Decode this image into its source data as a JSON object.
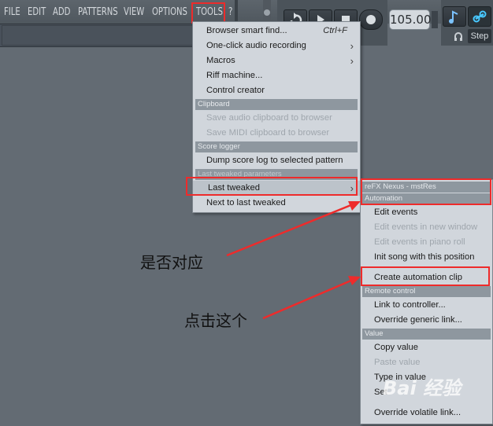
{
  "menubar": {
    "items": [
      "FILE",
      "EDIT",
      "ADD",
      "PATTERNS",
      "VIEW",
      "OPTIONS",
      "TOOLS",
      "?"
    ]
  },
  "transport": {
    "tempo": "105.000",
    "step_label": "Step"
  },
  "tools_menu": {
    "items": [
      {
        "label": "Browser smart find...",
        "shortcut": "Ctrl+F"
      },
      {
        "label": "One-click audio recording",
        "submenu": true
      },
      {
        "label": "Macros",
        "submenu": true
      },
      {
        "label": "Riff machine..."
      },
      {
        "label": "Control creator"
      }
    ],
    "clipboard_header": "Clipboard",
    "clipboard_items": [
      "Save audio clipboard to browser",
      "Save MIDI clipboard to browser"
    ],
    "score_header": "Score logger",
    "score_items": [
      "Dump score log to selected pattern"
    ],
    "last_tweaked_header": "Last tweaked parameters",
    "last_tweaked_items": [
      "Last tweaked",
      "Next to last tweaked"
    ]
  },
  "submenu": {
    "plugin_header": "reFX Nexus - mstRes",
    "automation_header": "Automation",
    "automation_items": [
      "Edit events",
      "Edit events in new window",
      "Edit events in piano roll",
      "Init song with this position",
      "Create automation clip"
    ],
    "remote_header": "Remote control",
    "remote_items": [
      "Link to controller...",
      "Override generic link..."
    ],
    "value_header": "Value",
    "value_items": [
      "Copy value",
      "Paste value",
      "Type in value",
      "Set",
      "Override volatile link..."
    ]
  },
  "annotations": {
    "question": "是否对应",
    "click_this": "点击这个"
  },
  "watermark": "Bai 经验",
  "colors": {
    "annotation_red": "#ee2b2b",
    "menu_bg": "#d1d6dc",
    "header_bg": "#8e979f",
    "app_bg": "#636b73"
  }
}
